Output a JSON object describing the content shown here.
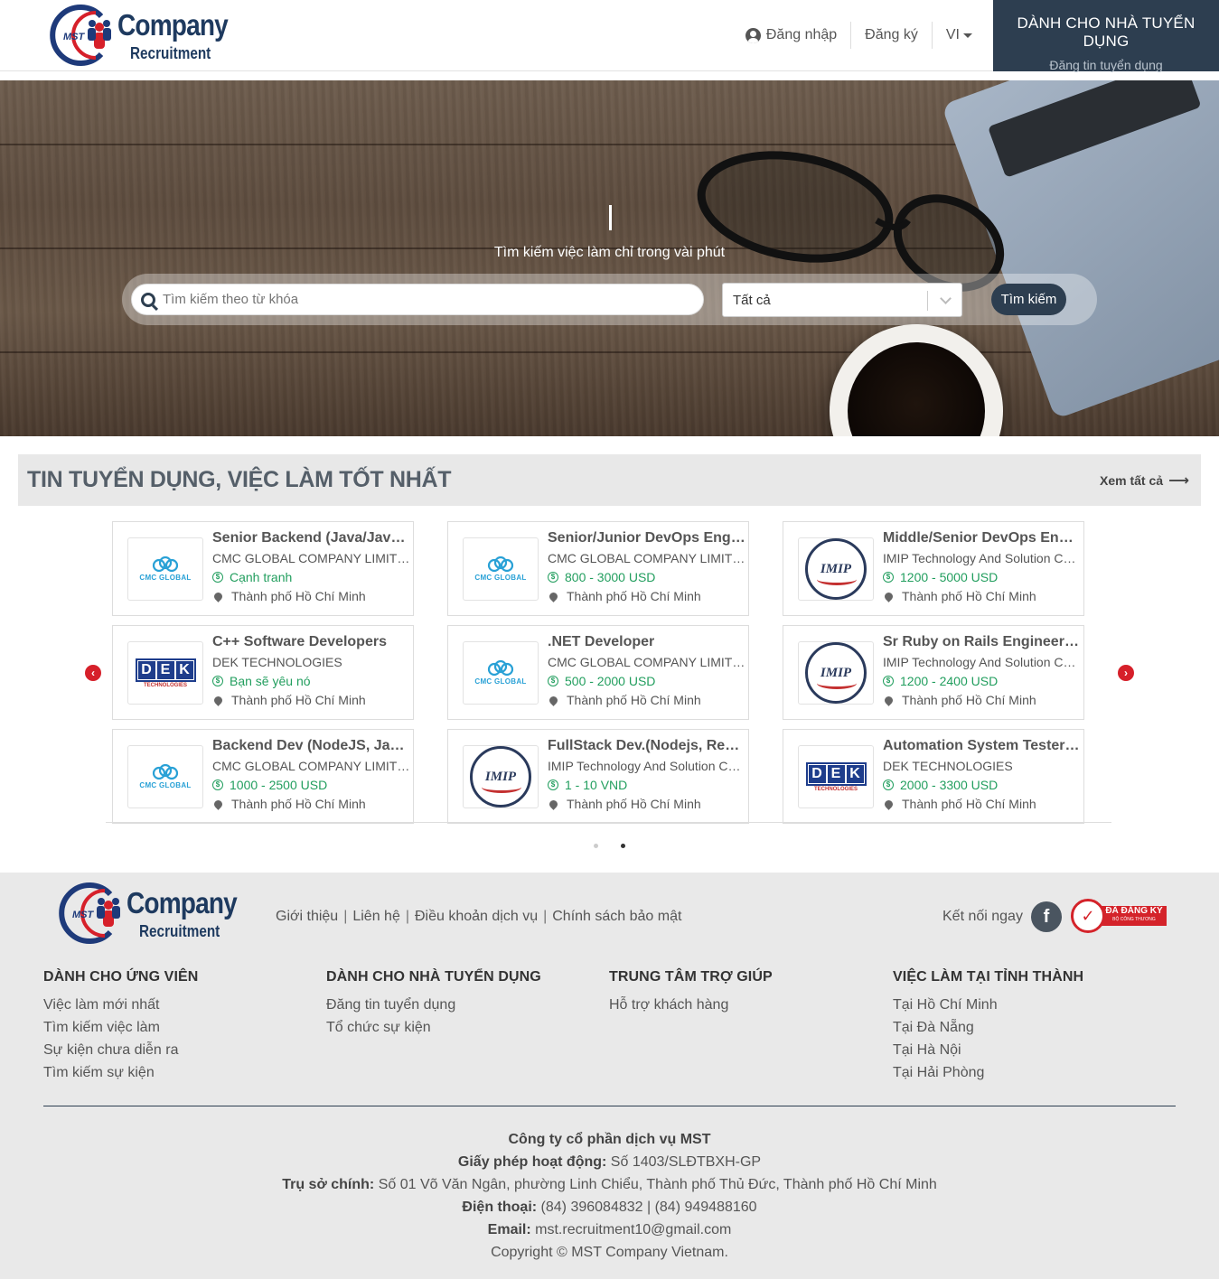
{
  "brand": {
    "mark": "MST",
    "name": "Company",
    "tagline": "Recruitment"
  },
  "header": {
    "login_label": "Đăng nhập",
    "register_label": "Đăng ký",
    "language": "VI",
    "employer_title": "DÀNH CHO NHÀ TUYỂN DỤNG",
    "employer_subtitle": "Đăng tin tuyển dụng"
  },
  "hero": {
    "tagline": "Tìm kiếm việc làm chỉ trong vài phút",
    "search_placeholder": "Tìm kiếm theo từ khóa",
    "category_value": "Tất cả",
    "search_button": "Tìm kiếm"
  },
  "jobs_section": {
    "title": "TIN TUYỂN DỤNG, VIỆC LÀM TỐT NHẤT",
    "see_all": "Xem tất cả",
    "arrow": "⟶",
    "jobs": [
      {
        "title": "Senior Backend (Java/JavaScript)",
        "company": "CMC GLOBAL COMPANY LIMITED",
        "salary": "Cạnh tranh",
        "location": "Thành phố Hồ Chí Minh",
        "logo": "cmc"
      },
      {
        "title": "Senior/Junior DevOps Engineer",
        "company": "CMC GLOBAL COMPANY LIMITED",
        "salary": "800 - 3000 USD",
        "location": "Thành phố Hồ Chí Minh",
        "logo": "cmc"
      },
      {
        "title": "Middle/Senior DevOps Engineer",
        "company": "IMIP Technology And Solution Company",
        "salary": "1200 - 5000 USD",
        "location": "Thành phố Hồ Chí Minh",
        "logo": "imip"
      },
      {
        "title": "C++ Software Developers",
        "company": "DEK TECHNOLOGIES",
        "salary": "Bạn sẽ yêu nó",
        "location": "Thành phố Hồ Chí Minh",
        "logo": "dek"
      },
      {
        "title": ".NET Developer",
        "company": "CMC GLOBAL COMPANY LIMITED",
        "salary": "500 - 2000 USD",
        "location": "Thành phố Hồ Chí Minh",
        "logo": "cmc"
      },
      {
        "title": "Sr Ruby on Rails Engineer - Backend",
        "company": "IMIP Technology And Solution Company",
        "salary": "1200 - 2400 USD",
        "location": "Thành phố Hồ Chí Minh",
        "logo": "imip"
      },
      {
        "title": "Backend Dev (NodeJS, Javascript)",
        "company": "CMC GLOBAL COMPANY LIMITED",
        "salary": "1000 - 2500 USD",
        "location": "Thành phố Hồ Chí Minh",
        "logo": "cmc"
      },
      {
        "title": "FullStack Dev.(Nodejs, Reactjs)",
        "company": "IMIP Technology And Solution Company",
        "salary": "1 - 10 VND",
        "location": "Thành phố Hồ Chí Minh",
        "logo": "imip"
      },
      {
        "title": "Automation System Tester (QA)",
        "company": "DEK TECHNOLOGIES",
        "salary": "2000 - 3300 USD",
        "location": "Thành phố Hồ Chí Minh",
        "logo": "dek"
      }
    ],
    "logo_texts": {
      "cmc": "CMC GLOBAL",
      "dek_letters": [
        "D",
        "E",
        "K"
      ],
      "dek_sub": "TECHNOLOGIES",
      "imip": "IMIP"
    },
    "salary_icon": "$",
    "pagination": {
      "pages": 2,
      "current": 2
    }
  },
  "footer": {
    "links": [
      "Giới thiệu",
      "Liên hệ",
      "Điều khoản dịch vụ",
      "Chính sách bảo mật"
    ],
    "link_separator": "|",
    "connect_label": "Kết nối ngay",
    "facebook_glyph": "f",
    "badge": {
      "title": "ĐÃ ĐĂNG KÝ",
      "subtitle": "BỘ CÔNG THƯƠNG"
    },
    "columns": [
      {
        "title": "DÀNH CHO ỨNG VIÊN",
        "items": [
          "Việc làm mới nhất",
          "Tìm kiếm việc làm",
          "Sự kiện chưa diễn ra",
          "Tìm kiếm sự kiện"
        ]
      },
      {
        "title": "DÀNH CHO NHÀ TUYỂN DỤNG",
        "items": [
          "Đăng tin tuyển dụng",
          "Tổ chức sự kiện"
        ]
      },
      {
        "title": "TRUNG TÂM TRỢ GIÚP",
        "items": [
          "Hỗ trợ khách hàng"
        ]
      },
      {
        "title": "VIỆC LÀM TẠI TỈNH THÀNH",
        "items": [
          "Tại Hồ Chí Minh",
          "Tại Đà Nẵng",
          "Tại Hà Nội",
          "Tại Hải Phòng"
        ]
      }
    ],
    "company_name": "Công ty cổ phần dịch vụ MST",
    "license_label": "Giấy phép hoạt động:",
    "license_value": "Số 1403/SLĐTBXH-GP",
    "hq_label": "Trụ sở chính:",
    "hq_value": "Số 01 Võ Văn Ngân, phường Linh Chiểu, Thành phố Thủ Đức, Thành phố Hồ Chí Minh",
    "phone_label": "Điện thoại:",
    "phone_value": "(84) 396084832 | (84) 949488160",
    "email_label": "Email:",
    "email_value": "mst.recruitment10@gmail.com",
    "copyright": "Copyright © MST Company Vietnam."
  },
  "colors": {
    "primary": "#2d3e50",
    "accent_red": "#d6202a",
    "salary_green": "#229e5e",
    "footer_bg": "#e9e9e9"
  },
  "icons": {
    "user": "user-circle-icon",
    "search": "search-icon",
    "prev": "chevron-left-icon",
    "next": "chevron-right-icon",
    "salary": "dollar-icon",
    "location": "map-pin-icon",
    "facebook": "facebook-icon"
  }
}
